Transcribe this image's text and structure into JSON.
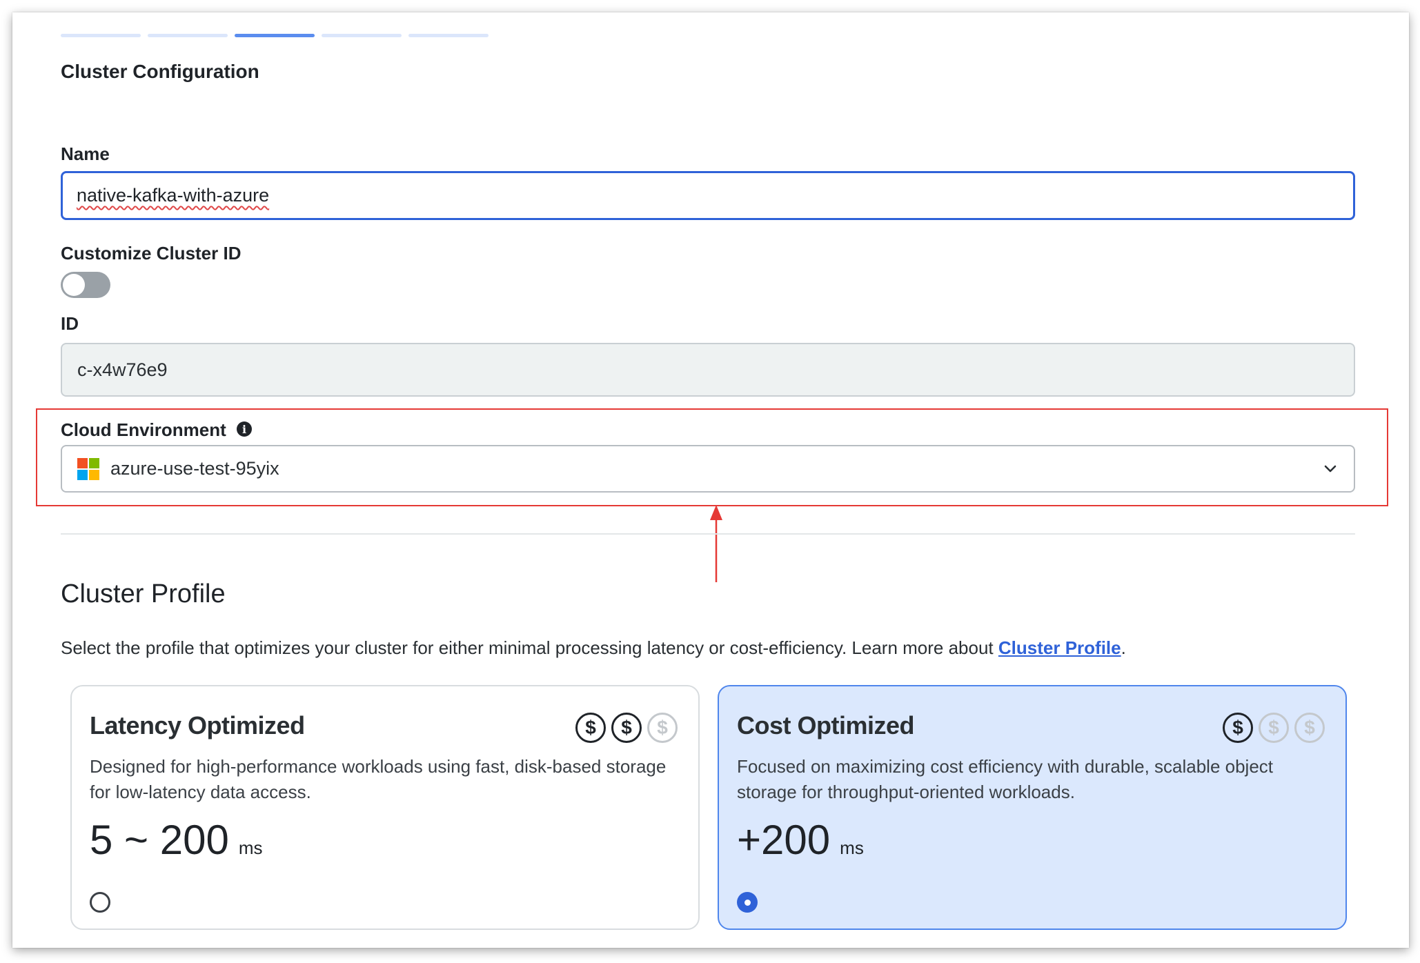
{
  "form": {
    "section_title": "Cluster Configuration",
    "steps": {
      "count": 5,
      "active_step": 3
    },
    "name": {
      "label": "Name",
      "value": "native-kafka-with-azure"
    },
    "customize_id": {
      "label": "Customize Cluster ID",
      "enabled": false
    },
    "id": {
      "label": "ID",
      "value": "c-x4w76e9"
    },
    "cloud_environment": {
      "label": "Cloud Environment",
      "info_icon": "info-icon",
      "selected": "azure-use-test-95yix",
      "provider_icon": "microsoft-logo-icon"
    }
  },
  "profile": {
    "title": "Cluster Profile",
    "description": "Select the profile that optimizes your cluster for either minimal processing latency or cost-efficiency. Learn more about",
    "link_text": "Cluster Profile",
    "trailing": ".",
    "options": [
      {
        "title": "Latency Optimized",
        "description": "Designed for high-performance workloads using fast, disk-based storage for low-latency data access.",
        "latency": "5 ~ 200",
        "unit": "ms",
        "cost_level": 2,
        "cost_max": 3,
        "coin_symbol": "$",
        "selected": false
      },
      {
        "title": "Cost Optimized",
        "description": "Focused on maximizing cost efficiency with durable, scalable object storage for throughput-oriented workloads.",
        "latency": "+200",
        "unit": "ms",
        "cost_level": 1,
        "cost_max": 3,
        "coin_symbol": "$",
        "selected": true
      }
    ]
  },
  "colors": {
    "accent": "#2f62d8",
    "highlight": "#e53935",
    "selected_card_bg": "#dbe8fd"
  }
}
